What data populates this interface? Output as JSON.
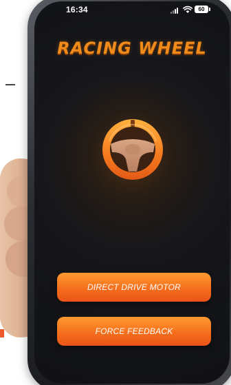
{
  "status_bar": {
    "time": "16:34",
    "battery": "60"
  },
  "app": {
    "title": "RACING WHEEL"
  },
  "buttons": {
    "direct_drive": "DIRECT DRIVE MOTOR",
    "force_feedback": "FORCE FEEDBACK"
  },
  "icons": {
    "wheel": "steering-wheel-icon",
    "signal": "signal-icon",
    "wifi": "wifi-icon",
    "battery": "battery-icon"
  },
  "colors": {
    "accent": "#f36b1c",
    "title": "#f08a1a",
    "background": "#131418"
  }
}
